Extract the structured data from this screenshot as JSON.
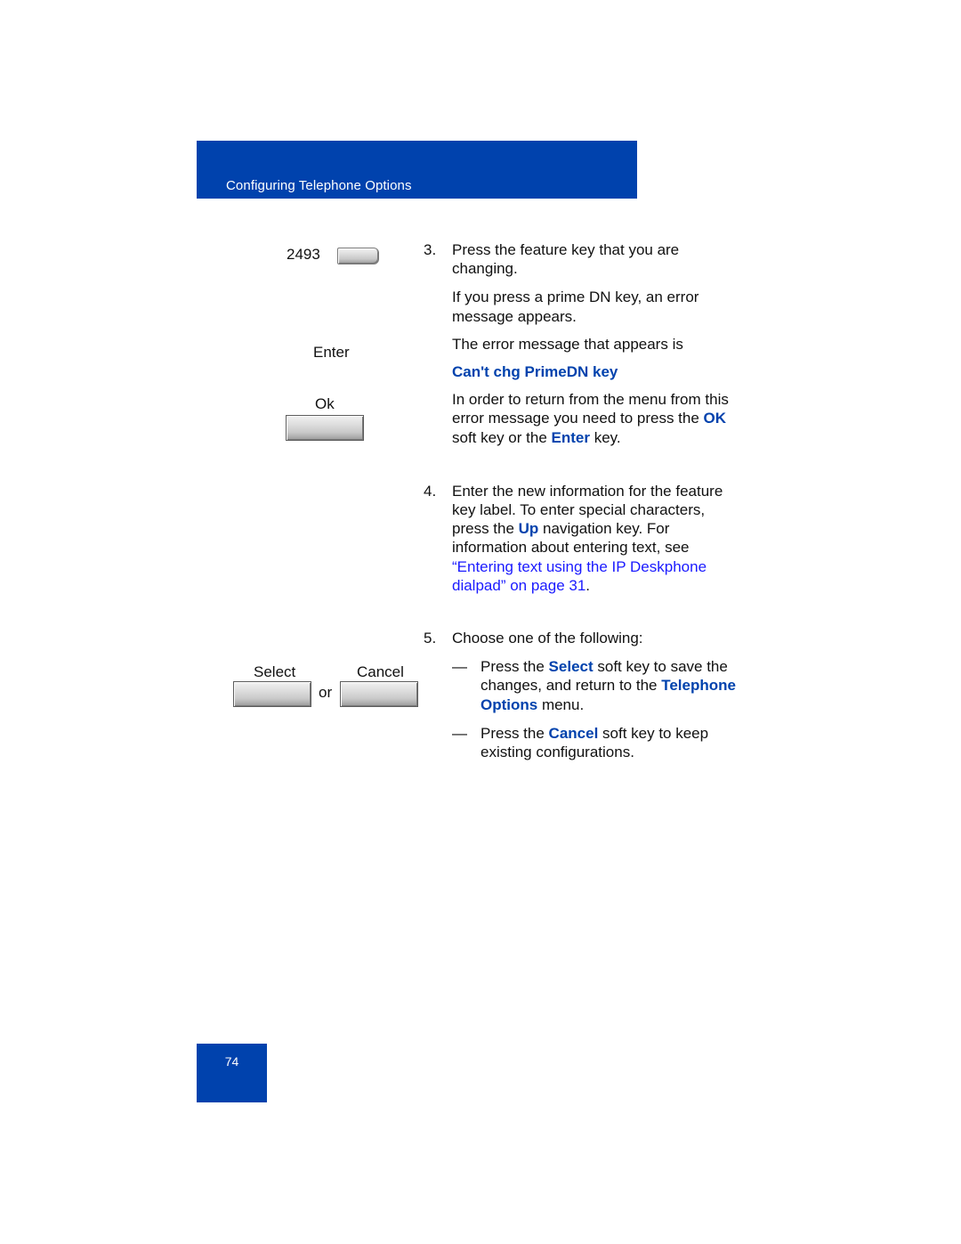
{
  "header": {
    "title": "Configuring Telephone Options"
  },
  "footer": {
    "page_number": "74"
  },
  "left_column": {
    "feature_key_label": "2493",
    "enter_label": "Enter",
    "ok_label": "Ok",
    "select_label": "Select",
    "or_label": "or",
    "cancel_label": "Cancel"
  },
  "steps": {
    "step3": {
      "number": "3.",
      "text": "Press the feature key that you are changing.",
      "para1": "If you press a prime DN key, an error message appears.",
      "para2": "The error message that appears is",
      "error_message": "Can't chg PrimeDN key",
      "para3_part1": "In order to return from the menu from this error message you need to press the ",
      "para3_ok": "OK",
      "para3_part2": " soft key or the ",
      "para3_enter": "Enter",
      "para3_part3": " key."
    },
    "step4": {
      "number": "4.",
      "part1": "Enter the new information for the feature key label. To enter special characters, press the ",
      "up": "Up",
      "part2": " navigation key. For information about entering text, see ",
      "link": "“Entering text using the IP Deskphone dialpad” on page 31",
      "part3": "."
    },
    "step5": {
      "number": "5.",
      "text": "Choose one of the following:",
      "bullets": [
        {
          "dash": "—",
          "part1": "Press the ",
          "key": "Select",
          "part2": " soft key to save the changes, and return to the ",
          "menu": "Telephone Options",
          "part3": " menu."
        },
        {
          "dash": "—",
          "part1": "Press the ",
          "key": "Cancel",
          "part2": " soft key to keep existing configurations."
        }
      ]
    }
  }
}
